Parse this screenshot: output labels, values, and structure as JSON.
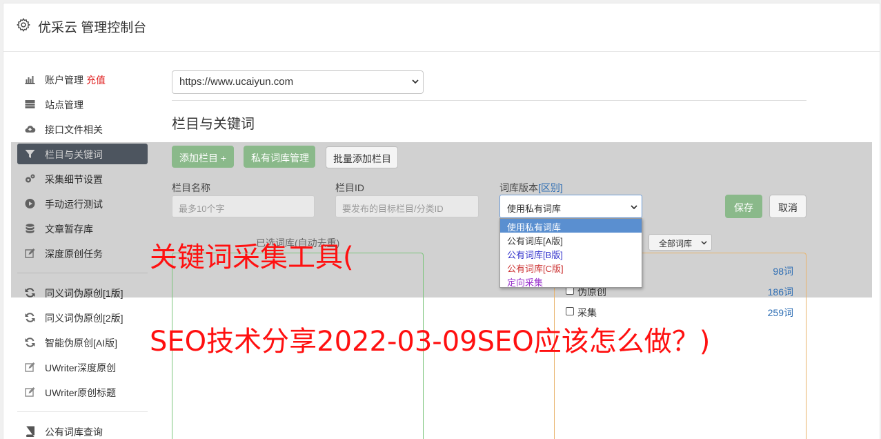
{
  "header": {
    "title": "优采云 管理控制台",
    "icon": "gear-icon"
  },
  "sidebar": {
    "items": [
      {
        "label": "账户管理",
        "extra": "充值",
        "icon": "bar-chart-icon"
      },
      {
        "label": "站点管理",
        "icon": "server-icon"
      },
      {
        "label": "接口文件相关",
        "icon": "cloud-upload-icon"
      },
      {
        "label": "栏目与关键词",
        "icon": "filter-icon",
        "active": true
      },
      {
        "label": "采集细节设置",
        "icon": "gears-icon"
      },
      {
        "label": "手动运行测试",
        "icon": "play-circle-icon"
      },
      {
        "label": "文章暂存库",
        "icon": "database-icon"
      },
      {
        "label": "深度原创任务",
        "icon": "edit-icon"
      },
      {
        "label": "同义词伪原创[1版]",
        "icon": "refresh-icon"
      },
      {
        "label": "同义词伪原创[2版]",
        "icon": "refresh-icon"
      },
      {
        "label": "智能伪原创[AI版]",
        "icon": "refresh-icon"
      },
      {
        "label": "UWriter深度原创",
        "icon": "edit-icon"
      },
      {
        "label": "UWriter原创标题",
        "icon": "edit-icon"
      },
      {
        "label": "公有词库查询",
        "icon": "book-icon"
      }
    ]
  },
  "main": {
    "site_select": "https://www.ucaiyun.com",
    "section_title": "栏目与关键词",
    "buttons": {
      "add_column": "添加栏目 +",
      "private_lib": "私有词库管理",
      "batch_add": "批量添加栏目",
      "save": "保存",
      "cancel": "取消"
    },
    "form": {
      "name_label": "栏目名称",
      "name_placeholder": "最多10个字",
      "id_label": "栏目ID",
      "id_placeholder": "要发布的目标栏目/分类ID",
      "lib_label": "词库版本",
      "lib_link": "[区别]",
      "lib_value": "使用私有词库"
    },
    "dropdown": {
      "options": [
        {
          "label": "使用私有词库",
          "color": "#ffffff"
        },
        {
          "label": "公有词库[A版]",
          "color": "#333333"
        },
        {
          "label": "公有词库[B版]",
          "color": "#3333cc"
        },
        {
          "label": "公有词库[C版]",
          "color": "#cc3333"
        },
        {
          "label": "定向采集",
          "color": "#9933cc"
        }
      ]
    },
    "selected_caption": "已选词库(自动去重)",
    "all_libraries": "全部词库",
    "categories": [
      {
        "name": "",
        "count": "98词"
      },
      {
        "name": "伪原创",
        "count": "186词"
      },
      {
        "name": "采集",
        "count": "259词"
      }
    ]
  },
  "overlay": {
    "line1": "关键词采集工具(",
    "line2": "SEO技术分享2022-03-09SEO应该怎么做？)"
  }
}
